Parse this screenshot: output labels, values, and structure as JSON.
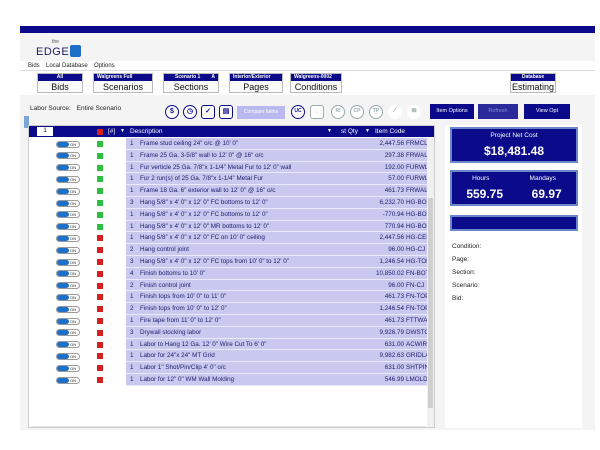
{
  "app": {
    "logo_small": "the",
    "logo_main": "EDGE"
  },
  "menu": [
    "Bids",
    "Local Database",
    "Options"
  ],
  "nav": [
    {
      "top": "All",
      "top_right": "",
      "label": "Bids"
    },
    {
      "top": "Walgreens Full Project",
      "top_right": "",
      "label": "Scenarios"
    },
    {
      "top": "Scenario 1",
      "top_right": "A",
      "label": "Sections"
    },
    {
      "top": "Interior/Exterior",
      "top_right": "",
      "label": "Pages"
    },
    {
      "top": "Walgreens-0002",
      "top_right": "",
      "label": "Conditions"
    },
    {
      "top": "Database",
      "top_right": "",
      "label": "Estimating"
    }
  ],
  "toolbar": {
    "labor_source_label": "Labor Source:",
    "labor_source_value": "Entire Scenario",
    "compare_button": "Compare Items",
    "item_options": "Item Options",
    "refresh": "Refresh",
    "view_options": "View Opt",
    "icons": [
      "dollar-icon",
      "clock-icon",
      "check-icon",
      "document-icon",
      "uc-icon",
      "shapes-icon",
      "ri-icon",
      "cp-icon",
      "tp-icon",
      "wand-icon",
      "stack-icon"
    ],
    "uc_label": "UC",
    "ri_label": "RI",
    "cp_label": "CP",
    "tp_label": "TP"
  },
  "grid": {
    "index_value": "1",
    "col_num": "[#]",
    "col_desc": "Description",
    "col_qty": "st Qty",
    "col_code": "Item Code",
    "toggle_label": "ON",
    "rows": [
      {
        "num": "1",
        "desc": "Frame stud ceiling  24\" o/c @ 10' 0\"",
        "qty": "2,447.56",
        "code": "FRMCLSSF",
        "status": "green"
      },
      {
        "num": "1",
        "desc": "Frame 25 Ga. 3-5/8\" wall to 12' 0\" @ 16\" o/c",
        "qty": "297.38",
        "code": "FRWALF",
        "status": "green"
      },
      {
        "num": "1",
        "desc": "Fur verticle 25 Ga. 7/8\"x 1-1/4\" Metal Fur to 12' 0\" wall",
        "qty": "192.00",
        "code": "FURWLF",
        "status": "green"
      },
      {
        "num": "1",
        "desc": "Fur 2 run(s) of 25 Ga. 7/8\"x 1-1/4\" Metal Fur",
        "qty": "57.00",
        "code": "FURWLFH",
        "status": "green"
      },
      {
        "num": "1",
        "desc": "Frame 18 Ga. 6\" exterior wall to 12' 0\" @ 16\" o/c",
        "qty": "461.73",
        "code": "FRWALFX",
        "status": "green"
      },
      {
        "num": "3",
        "desc": "Hang 5/8\" x 4' 0\" x 12' 0\" FC bottoms to 12' 0\"",
        "qty": "6,232.70",
        "code": "HG-BOTTOM",
        "status": "green"
      },
      {
        "num": "1",
        "desc": "Hang 5/8\" x 4' 0\" x 12' 0\" FC bottoms to 12' 0\"",
        "qty": "-770.94",
        "code": "HG-BOTTOM",
        "status": "green"
      },
      {
        "num": "1",
        "desc": "Hang 5/8\" x 4' 0\" x 12' 0\" MR bottoms to 12' 0\"",
        "qty": "770.94",
        "code": "HG-BOTTOM",
        "status": "green"
      },
      {
        "num": "1",
        "desc": "Hang 5/8\" x 4' 0\" x 12' 0\" FC on 10' 0\" ceiling",
        "qty": "2,447.56",
        "code": "HG-CEILING",
        "status": "red"
      },
      {
        "num": "2",
        "desc": "Hang control joint",
        "qty": "96.00",
        "code": "HG-CJ",
        "status": "red"
      },
      {
        "num": "3",
        "desc": "Hang 5/8\" x 4' 0\" x 12' 0\" FC tops from 10' 0\" to 12' 0\"",
        "qty": "1,246.54",
        "code": "HG-TOPS",
        "status": "red"
      },
      {
        "num": "4",
        "desc": "Finish bottoms to 10' 0\"",
        "qty": "10,850.02",
        "code": "FN-BOTTOM",
        "status": "red"
      },
      {
        "num": "2",
        "desc": "Finish control joint",
        "qty": "96.00",
        "code": "FN-CJ",
        "status": "red"
      },
      {
        "num": "1",
        "desc": "Finish tops from 10' 0\" to 11' 0\"",
        "qty": "461.73",
        "code": "FN-TOPS",
        "status": "red"
      },
      {
        "num": "2",
        "desc": "Finish tops from 10' 0\" to 12' 0\"",
        "qty": "1,246.54",
        "code": "FN-TOPS",
        "status": "red"
      },
      {
        "num": "1",
        "desc": "Fire tape from 11' 0\" to 12' 0\"",
        "qty": "461.73",
        "code": "FTTWASF",
        "status": "red"
      },
      {
        "num": "3",
        "desc": "Drywall stocking labor",
        "qty": "9,926.79",
        "code": "DWSTOCK",
        "status": "red"
      },
      {
        "num": "1",
        "desc": "Labor to Hang 12 Ga. 12' 0\" Wire Cut To 6' 0\"",
        "qty": "631.00",
        "code": "ACWIREL",
        "status": "red"
      },
      {
        "num": "1",
        "desc": "Labor for 24\"x 24\" MT Grid",
        "qty": "9,982.63",
        "code": "GRIDLAB",
        "status": "red"
      },
      {
        "num": "1",
        "desc": "Labor 1\" Shot/Pin/Clip 4' 0\" o/c",
        "qty": "631.00",
        "code": "SHTPINLAB",
        "status": "red"
      },
      {
        "num": "1",
        "desc": "Labor for 12\" 0\" WM Wall Molding",
        "qty": "546.99",
        "code": "LMOLDLAB",
        "status": "red"
      }
    ]
  },
  "summary": {
    "net_cost_label": "Project Net Cost",
    "net_cost_value": "$18,481.48",
    "hours_label": "Hours",
    "hours_value": "559.75",
    "mandays_label": "Mandays",
    "mandays_value": "69.97",
    "fields": [
      "Condition:",
      "Page:",
      "Section:",
      "Scenario:",
      "Bid:"
    ]
  },
  "colors": {
    "navy": "#0a0a8a",
    "row_bg": "#c9c9ef",
    "green": "#2fbf3f",
    "red": "#d62020"
  }
}
